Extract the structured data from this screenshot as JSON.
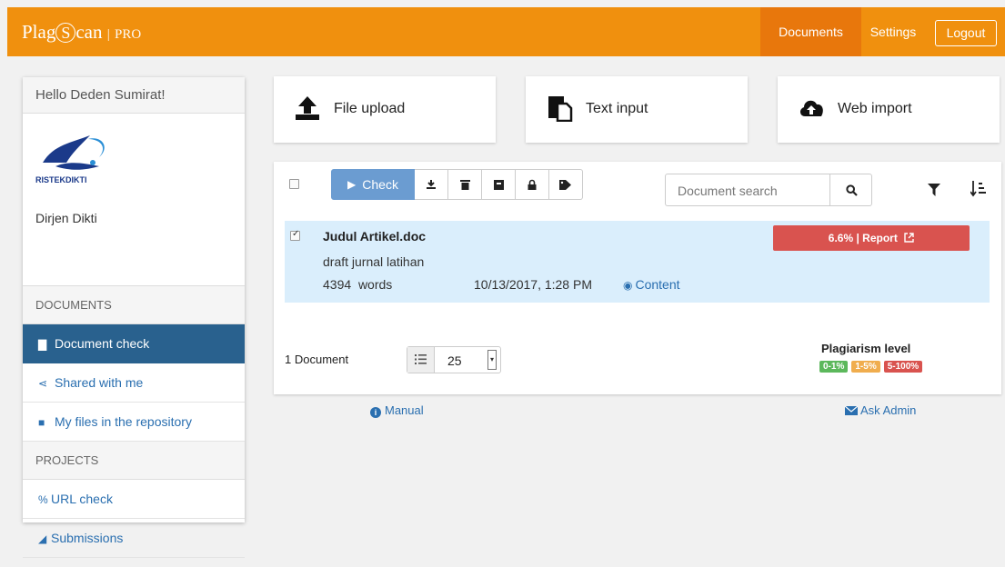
{
  "brand": {
    "name": "Plag",
    "name_mid": "S",
    "name_end": "can",
    "divider": "|",
    "tier": "PRO"
  },
  "nav": {
    "documents": "Documents",
    "settings": "Settings",
    "logout": "Logout"
  },
  "sidebar": {
    "greeting": "Hello Deden Sumirat!",
    "org_logo_text": "RISTEKDIKTI",
    "profile_name": "Dirjen Dikti",
    "documents_heading": "DOCUMENTS",
    "items": [
      {
        "label": "Document check",
        "icon": "file-icon"
      },
      {
        "label": "Shared with me",
        "icon": "share-icon"
      },
      {
        "label": "My files in the repository",
        "icon": "archive-icon"
      }
    ],
    "projects_heading": "PROJECTS",
    "project_items": [
      {
        "label": "URL check",
        "icon": "link-icon"
      },
      {
        "label": "Submissions",
        "icon": "paper-plane-icon"
      }
    ]
  },
  "upload_cards": [
    {
      "label": "File upload",
      "icon": "upload-icon"
    },
    {
      "label": "Text input",
      "icon": "paste-icon"
    },
    {
      "label": "Web import",
      "icon": "cloud-upload-icon"
    }
  ],
  "toolbar": {
    "check_label": "Check",
    "search_placeholder": "Document search"
  },
  "documents": [
    {
      "title": "Judul Artikel.doc",
      "description": "draft jurnal latihan",
      "word_count": "4394",
      "words_label": "words",
      "date": "10/13/2017, 1:28 PM",
      "content_link": "Content",
      "report_label": "6.6% | Report",
      "selected": true
    }
  ],
  "footer": {
    "document_count": "1 Document",
    "per_page": "25",
    "plagiarism_title": "Plagiarism level",
    "levels": [
      {
        "label": "0-1%",
        "color": "#5cb85c"
      },
      {
        "label": "1-5%",
        "color": "#f0ad4e"
      },
      {
        "label": "5-100%",
        "color": "#d9534f"
      }
    ]
  },
  "links": {
    "manual": "Manual",
    "ask_admin": "Ask Admin"
  },
  "colors": {
    "header": "#f0900e",
    "header_active": "#e8770c",
    "sidebar_active": "#29618e",
    "link": "#2a6fb0",
    "row_selected": "#daeefc",
    "check_button": "#6b9cd1",
    "report": "#d9534f"
  }
}
